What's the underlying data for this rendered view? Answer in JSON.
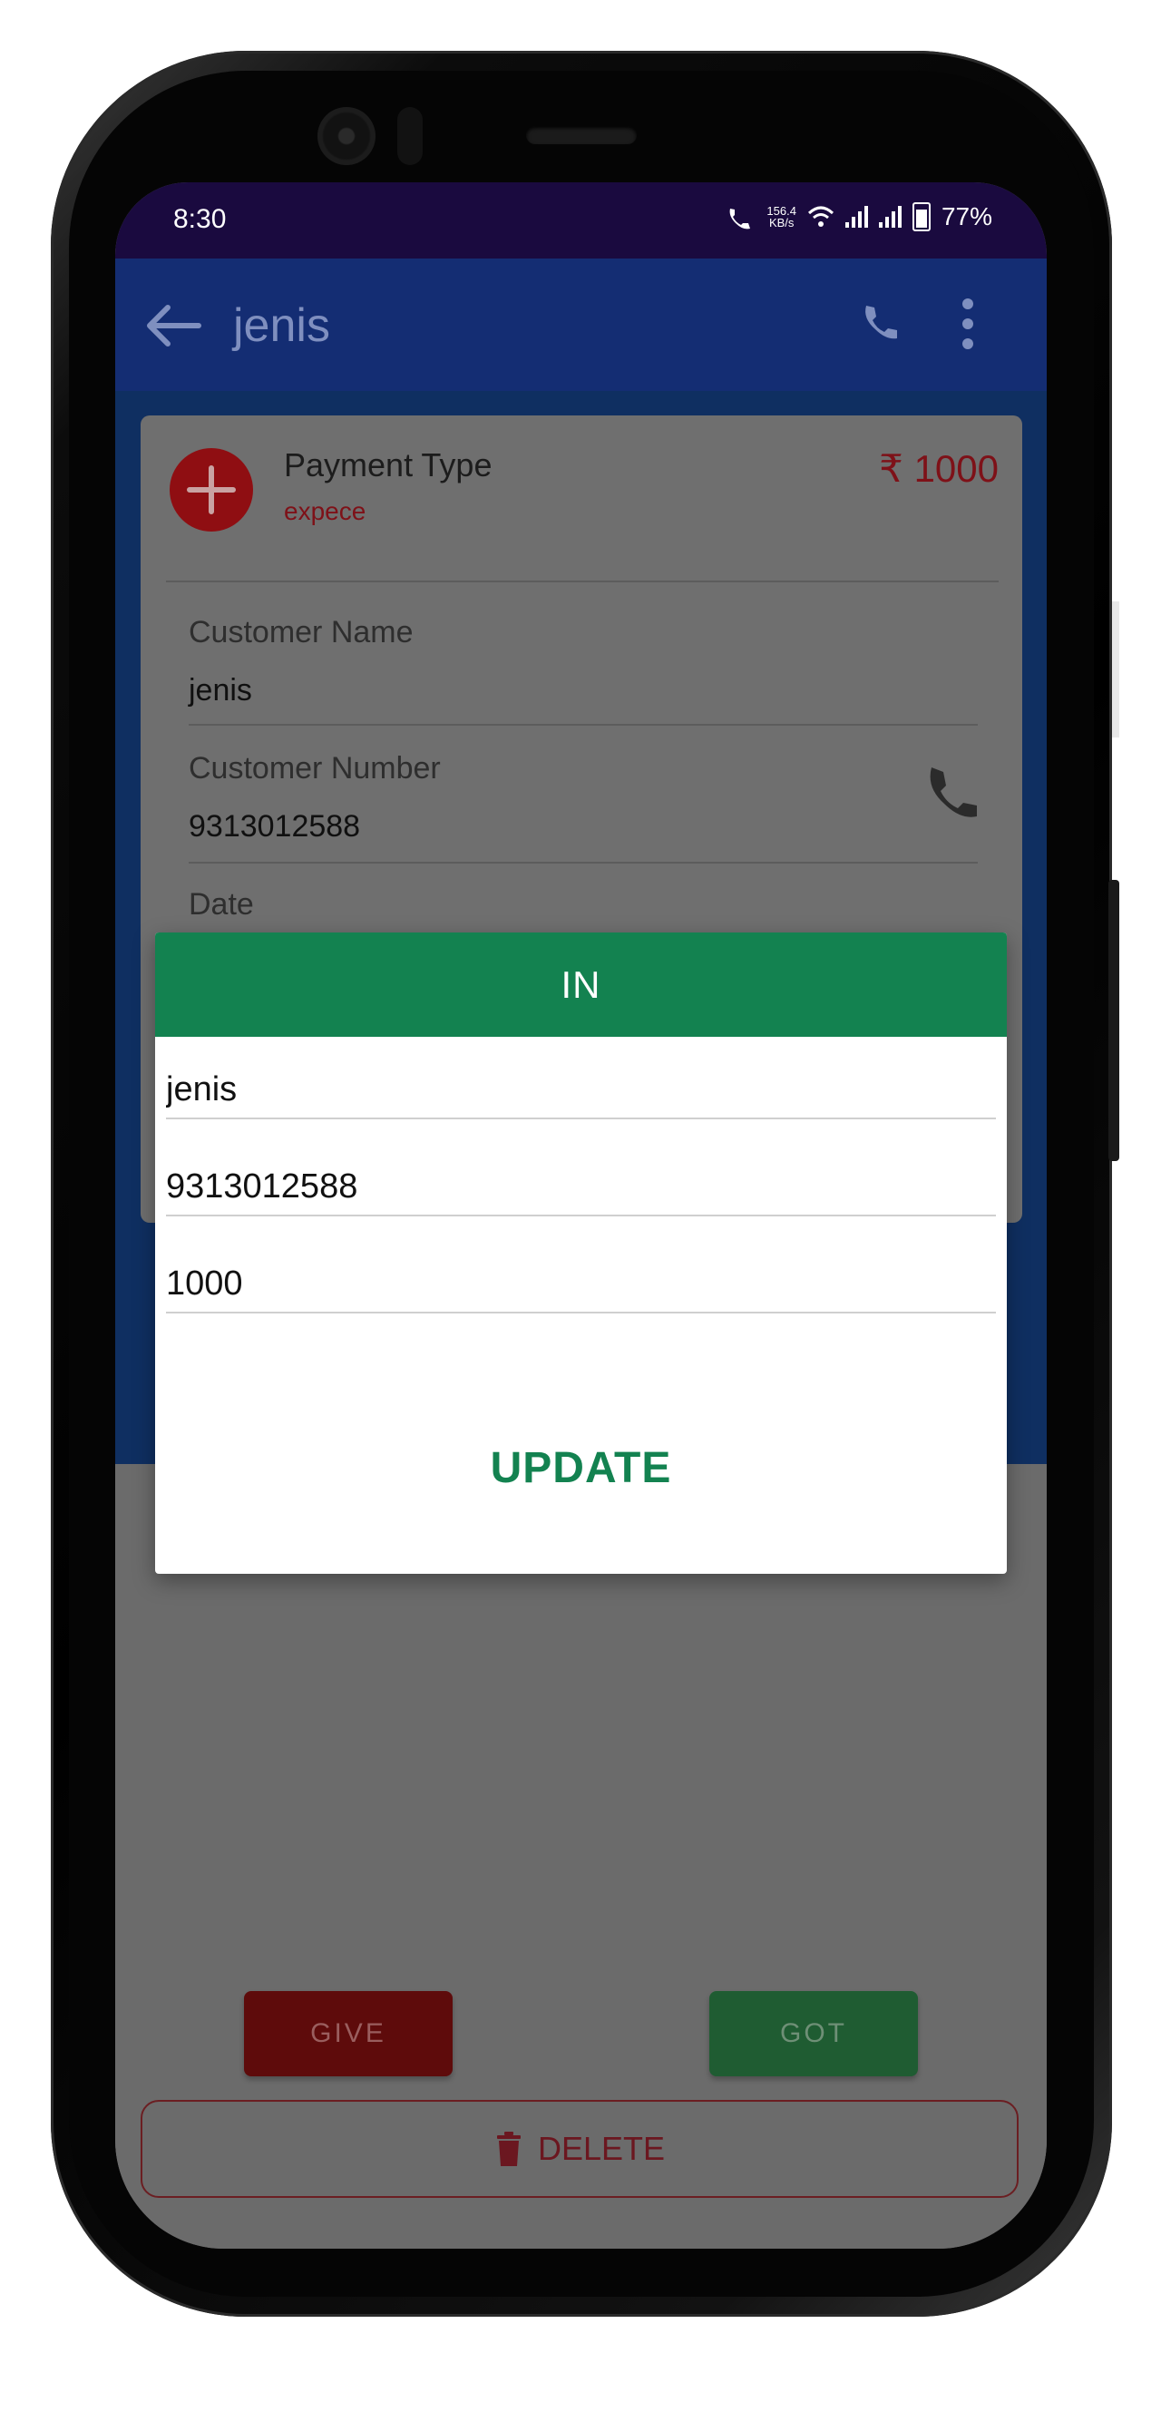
{
  "status_bar": {
    "time": "8:30",
    "net_speed_top": "156.4",
    "net_speed_bottom": "KB/s",
    "battery": "77%"
  },
  "app_bar": {
    "title": "jenis",
    "back_icon": "arrow-left-icon",
    "call_icon": "phone-icon",
    "menu_icon": "more-vertical-icon"
  },
  "card": {
    "payment_type_label": "Payment Type",
    "payment_type_value": "expece",
    "amount": "₹ 1000",
    "customer_name_label": "Customer Name",
    "customer_name_value": "jenis",
    "customer_number_label": "Customer Number",
    "customer_number_value": "9313012588",
    "date_label": "Date"
  },
  "dialog": {
    "title": "IN",
    "name_value": "jenis",
    "number_value": "9313012588",
    "amount_value": "1000",
    "update_label": "UPDATE"
  },
  "actions": {
    "give_label": "GIVE",
    "got_label": "GOT",
    "delete_label": "DELETE"
  },
  "colors": {
    "app_bar": "#142d73",
    "status_bar": "#1a0a3f",
    "dialog_header": "#138250",
    "accent_red": "#b71c1c",
    "accent_green": "#138250"
  }
}
